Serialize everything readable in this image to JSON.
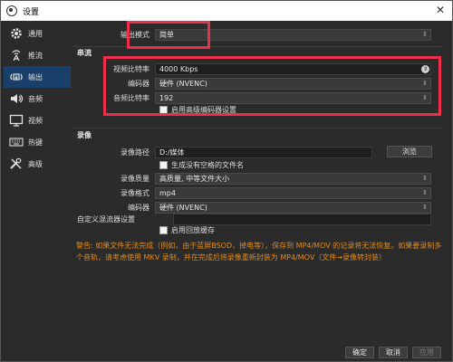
{
  "window": {
    "title": "设置"
  },
  "sidebar": {
    "items": [
      {
        "label": "通用",
        "icon": "gear-icon"
      },
      {
        "label": "推流",
        "icon": "antenna-icon"
      },
      {
        "label": "输出",
        "icon": "output-icon"
      },
      {
        "label": "音频",
        "icon": "speaker-icon"
      },
      {
        "label": "视频",
        "icon": "monitor-icon"
      },
      {
        "label": "热键",
        "icon": "keyboard-icon"
      },
      {
        "label": "高级",
        "icon": "tools-icon"
      }
    ],
    "active_index": 2
  },
  "output_mode": {
    "label": "输出模式",
    "value": "简单"
  },
  "streaming": {
    "heading": "串流",
    "video_bitrate": {
      "label": "视频比特率",
      "value": "4000 Kbps"
    },
    "encoder": {
      "label": "编码器",
      "value": "硬件 (NVENC)"
    },
    "audio_bitrate": {
      "label": "音频比特率",
      "value": "192"
    },
    "advanced_checkbox": {
      "label": "启用高级编码器设置",
      "checked": false
    }
  },
  "recording": {
    "heading": "录像",
    "path": {
      "label": "录像路径",
      "value": "D:/媒体"
    },
    "browse_button": "浏览",
    "no_space_checkbox": {
      "label": "生成没有空格的文件名",
      "checked": false
    },
    "quality": {
      "label": "录像质量",
      "value": "高质量, 中等文件大小"
    },
    "format": {
      "label": "录像格式",
      "value": "mp4"
    },
    "encoder": {
      "label": "编码器",
      "value": "硬件 (NVENC)"
    },
    "muxer": {
      "label": "自定义混流器设置",
      "value": ""
    },
    "replay_checkbox": {
      "label": "启用回放缓存",
      "checked": false
    }
  },
  "warning": "警告: 如果文件无法完成（例如，由于蓝屏BSOD，掉电等），保存到 MP4/MOV 的记录将无法恢复。如果要录制多个音轨，请考虑使用 MKV 录制，并在完成后将录像重新封装为 MP4/MOV（文件→录像转封装）",
  "footer": {
    "ok": "确定",
    "cancel": "取消",
    "apply": "应用"
  },
  "colors": {
    "accent": "#19406a",
    "highlight_box": "#ee2f4b",
    "warning": "#e08a1e"
  }
}
